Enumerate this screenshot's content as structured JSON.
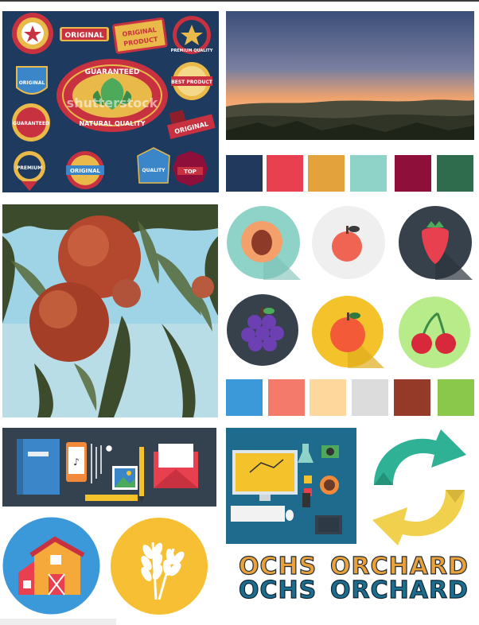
{
  "badges": {
    "original_1": "ORIGINAL",
    "original_product_1": "ORIGINAL",
    "original_product_2": "PRODUCT",
    "original_2": "ORIGINAL",
    "original_3": "ORIGINAL",
    "guaranteed_1": "GUARANTEED",
    "guaranteed_2": "GUARANTEED",
    "natural_quality": "NATURAL QUALITY",
    "best_product": "BEST PRODUCT",
    "premium": "PREMIUM",
    "quality": "QUALITY",
    "top": "TOP",
    "original_blue": "ORIGINAL",
    "premium_quality": "PREMIUM QUALITY",
    "watermark": "shutterstock"
  },
  "palette1": [
    "#21395c",
    "#e8404f",
    "#e3a23c",
    "#8fd3c8",
    "#8d0f3a",
    "#2f6b4d"
  ],
  "palette2": [
    "#3b98d9",
    "#f47a6b",
    "#fdd79b",
    "#dcdcdc",
    "#953928",
    "#89c84b"
  ],
  "fruit_icons": [
    "peach-icon",
    "apple-icon",
    "strawberry-icon",
    "grapes-icon",
    "apple-icon",
    "cherries-icon"
  ],
  "logo_text": {
    "line1_word1": "OCHS",
    "line1_word2": "ORCHARD",
    "line2_word1": "OCHS",
    "line2_word2": "ORCHARD"
  },
  "colors": {
    "navy": "#1f3a5f",
    "dark_slate": "#34414e",
    "teal_panel": "#1f6b8d",
    "orange": "#e9a23b"
  }
}
